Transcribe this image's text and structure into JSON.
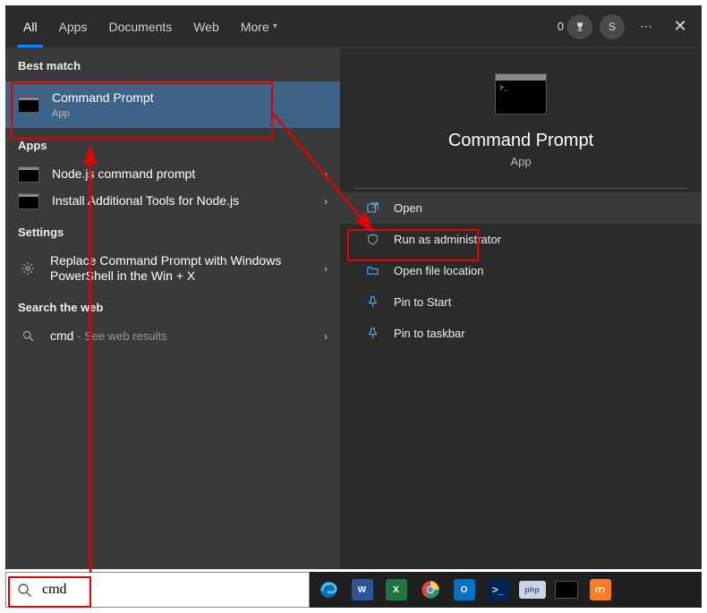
{
  "tabs": {
    "all": "All",
    "apps": "Apps",
    "documents": "Documents",
    "web": "Web",
    "more": "More"
  },
  "header": {
    "count": "0",
    "user_initial": "S"
  },
  "sections": {
    "best_match": "Best match",
    "apps": "Apps",
    "settings": "Settings",
    "web": "Search the web"
  },
  "best_match": {
    "title": "Command Prompt",
    "sub": "App"
  },
  "apps_list": [
    {
      "title": "Node.js command prompt"
    },
    {
      "title": "Install Additional Tools for Node.js"
    }
  ],
  "settings_list": [
    {
      "title": "Replace Command Prompt with Windows PowerShell in the Win + X"
    }
  ],
  "web": {
    "query": "cmd",
    "suffix": " - See web results"
  },
  "preview": {
    "title": "Command Prompt",
    "sub": "App"
  },
  "actions": {
    "open": "Open",
    "run_admin": "Run as administrator",
    "open_loc": "Open file location",
    "pin_start": "Pin to Start",
    "pin_taskbar": "Pin to taskbar"
  },
  "search": {
    "value": "cmd"
  },
  "taskbar": {
    "word": "W",
    "excel": "X",
    "outlook": "O",
    "ps": ">_",
    "php": "php",
    "xampp": "ဢ"
  }
}
